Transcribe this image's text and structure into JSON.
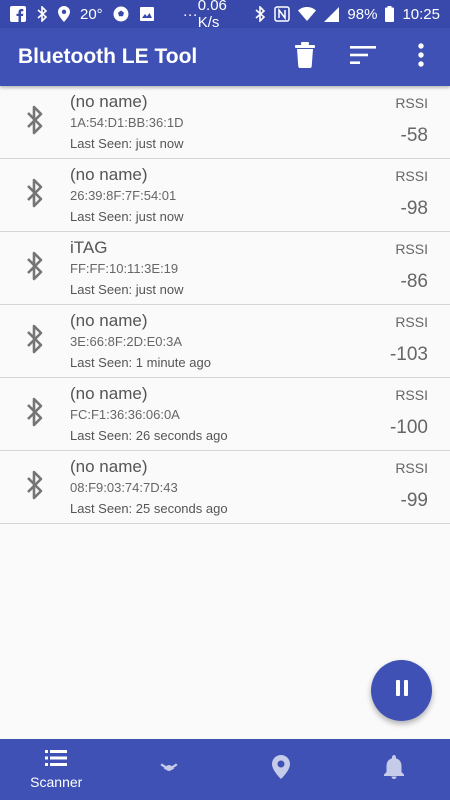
{
  "status_bar": {
    "temperature": "20°",
    "more": "···",
    "network_speed": "0.06 K/s",
    "battery": "98%",
    "time": "10:25"
  },
  "app_bar": {
    "title": "Bluetooth LE Tool",
    "actions": [
      "trash-icon",
      "sort-icon",
      "more-vert-icon"
    ]
  },
  "devices": [
    {
      "name": "(no name)",
      "address": "1A:54:D1:BB:36:1D",
      "last_seen": "Last Seen: just now",
      "rssi_label": "RSSI",
      "rssi": "-58"
    },
    {
      "name": "(no name)",
      "address": "26:39:8F:7F:54:01",
      "last_seen": "Last Seen: just now",
      "rssi_label": "RSSI",
      "rssi": "-98"
    },
    {
      "name": "iTAG",
      "address": "FF:FF:10:11:3E:19",
      "last_seen": "Last Seen: just now",
      "rssi_label": "RSSI",
      "rssi": "-86"
    },
    {
      "name": "(no name)",
      "address": "3E:66:8F:2D:E0:3A",
      "last_seen": "Last Seen: 1 minute ago",
      "rssi_label": "RSSI",
      "rssi": "-103"
    },
    {
      "name": "(no name)",
      "address": "FC:F1:36:36:06:0A",
      "last_seen": "Last Seen: 26 seconds ago",
      "rssi_label": "RSSI",
      "rssi": "-100"
    },
    {
      "name": "(no name)",
      "address": "08:F9:03:74:7D:43",
      "last_seen": "Last Seen: 25 seconds ago",
      "rssi_label": "RSSI",
      "rssi": "-99"
    }
  ],
  "fab": {
    "icon": "pause-icon"
  },
  "bottom_nav": {
    "scanner_label": "Scanner",
    "items": [
      "scanner-list-icon",
      "broadcast-icon",
      "location-icon",
      "bell-icon"
    ]
  },
  "colors": {
    "primary": "#3f51b5",
    "status_bar": "#3949ab",
    "background": "#fafafa"
  }
}
